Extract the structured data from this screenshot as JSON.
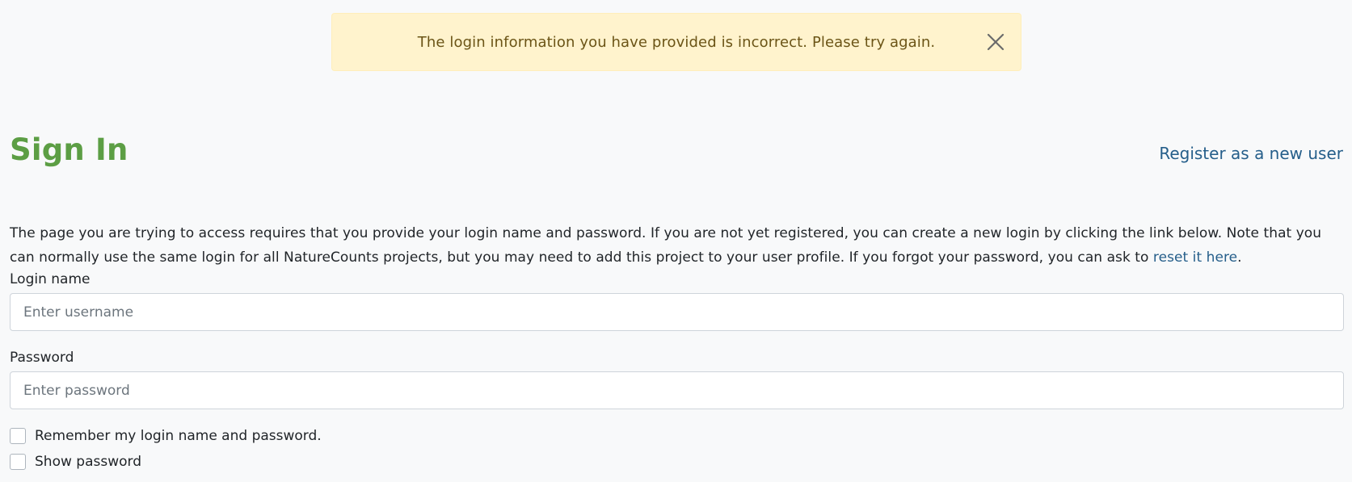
{
  "alert": {
    "message": "The login information you have provided is incorrect. Please try again.",
    "close_icon": "close-icon"
  },
  "header": {
    "title": "Sign In",
    "register_link": "Register as a new user"
  },
  "intro": {
    "text": "The page you are trying to access requires that you provide your login name and password. If you are not yet registered, you can create a new login by clicking the link below. Note that you can normally use the same login for all NatureCounts projects, but you may need to add this project to your user profile. If you forgot your password, you can ask to ",
    "reset_link": "reset it here",
    "suffix": "."
  },
  "form": {
    "login_label": "Login name",
    "login_placeholder": "Enter username",
    "password_label": "Password",
    "password_placeholder": "Enter password",
    "remember_label": "Remember my login name and password.",
    "show_password_label": "Show password"
  },
  "colors": {
    "title": "#5c9e44",
    "link": "#255e8a",
    "alert_bg": "#fff3cd",
    "alert_text": "#6b5416"
  }
}
